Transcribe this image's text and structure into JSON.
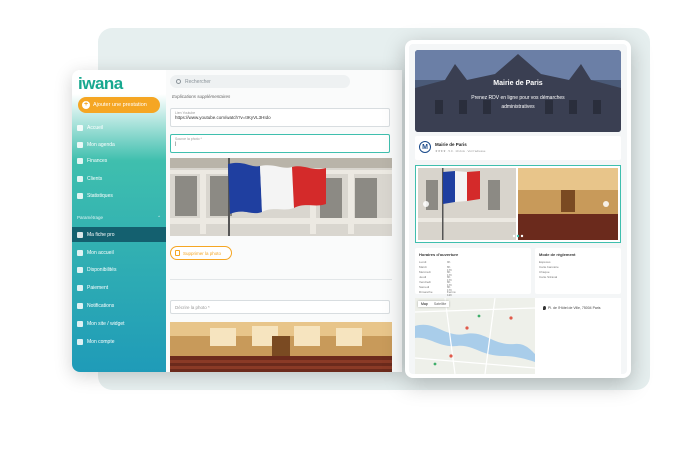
{
  "app": {
    "logo": "iwana",
    "add_button": "Ajouter une prestation"
  },
  "sidebar": {
    "items": [
      {
        "label": "Accueil",
        "icon": "home-icon"
      },
      {
        "label": "Mon agenda",
        "icon": "calendar-icon"
      },
      {
        "label": "Finances",
        "icon": "finance-icon"
      },
      {
        "label": "Clients",
        "icon": "users-icon"
      },
      {
        "label": "Statistiques",
        "icon": "stats-icon"
      }
    ],
    "section_label": "Paramétrage",
    "settings_items": [
      {
        "label": "Ma fiche pro",
        "icon": "profile-card-icon",
        "active": true
      },
      {
        "label": "Mon accueil",
        "icon": "reception-icon",
        "active": false
      },
      {
        "label": "Disponibilités",
        "icon": "availability-icon",
        "active": false
      },
      {
        "label": "Paiement",
        "icon": "payment-icon",
        "active": false
      },
      {
        "label": "Notifications",
        "icon": "bell-icon",
        "active": false
      },
      {
        "label": "Mon site / widget",
        "icon": "widget-icon",
        "active": false
      },
      {
        "label": "Mon compte",
        "icon": "account-icon",
        "active": false
      }
    ]
  },
  "main": {
    "search_placeholder": "Rechercher",
    "section_title": "Explications supplémentaires",
    "video_field": {
      "label": "Lien Youtube",
      "value": "https://www.youtube.com/watch?v=tIKyVL3HIdo"
    },
    "photo_field": {
      "label": "Source la photo *",
      "value": "|"
    },
    "delete_photo": "Supprimer la photo",
    "describe_field": {
      "label": "Décrire la photo *"
    }
  },
  "preview": {
    "hero_title": "Mairie de Paris",
    "hero_subtitle": "Prenez RDV en ligne pour vos démarches administratives",
    "org_avatar": "M",
    "org_name": "Mairie de Paris",
    "org_meta": "★★★★  ·  5.0  ·  10 Avis  ·  Voir l'adresse",
    "hours_title": "Horaires d'ouverture",
    "hours": [
      {
        "day": "Lundi",
        "time": "9h - 17h"
      },
      {
        "day": "Mardi",
        "time": "9h - 17h"
      },
      {
        "day": "Mercredi",
        "time": "9h - 17h"
      },
      {
        "day": "Jeudi",
        "time": "9h - 17h"
      },
      {
        "day": "Vendredi",
        "time": "9h - 17h"
      },
      {
        "day": "Samedi",
        "time": "9h - 12h"
      },
      {
        "day": "Dimanche",
        "time": "Fermé"
      }
    ],
    "payment_title": "Mode de règlement",
    "payment_methods": [
      "Espèces",
      "Carte bancaire",
      "Chèque",
      "Carte Sitraval"
    ],
    "map_tabs": [
      "Map",
      "Satellite"
    ],
    "address": "Pl. de l'Hôtel de Ville, 75004 Paris"
  },
  "colors": {
    "brand_green": "#17a88f",
    "accent_orange": "#f5a623",
    "sidebar_active": "#14606f"
  }
}
